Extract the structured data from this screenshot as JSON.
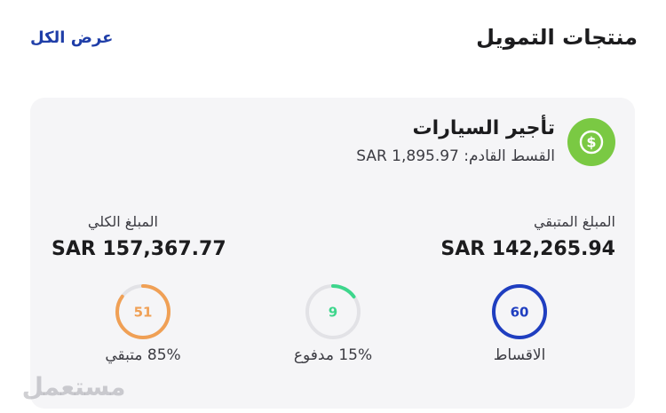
{
  "header": {
    "title": "منتجات التمويل",
    "view_all": "عرض الكل"
  },
  "card": {
    "product_name": "تأجير السيارات",
    "next_installment": "القسط القادم: SAR 1,895.97",
    "icon": "dollar-coin-icon",
    "remaining_amount_label": "المبلغ المتبقي",
    "remaining_amount_value": "SAR 142,265.94",
    "total_amount_label": "المبلغ الكلي",
    "total_amount_value": "SAR 157,367.77",
    "stats": {
      "installments": {
        "value": "60",
        "label": "الاقساط",
        "progress": 1.0,
        "color": "#1f3ec0"
      },
      "paid": {
        "value": "9",
        "label": "15% مدفوع",
        "progress": 0.15,
        "color": "#3dd68c"
      },
      "remaining": {
        "value": "51",
        "label": "85% متبقي",
        "progress": 0.85,
        "color": "#f0a055"
      }
    }
  },
  "watermark": "مستعمل",
  "colors": {
    "link": "#1f3ea8",
    "icon_bg": "#7ac943",
    "card_bg": "#f5f5f7"
  }
}
